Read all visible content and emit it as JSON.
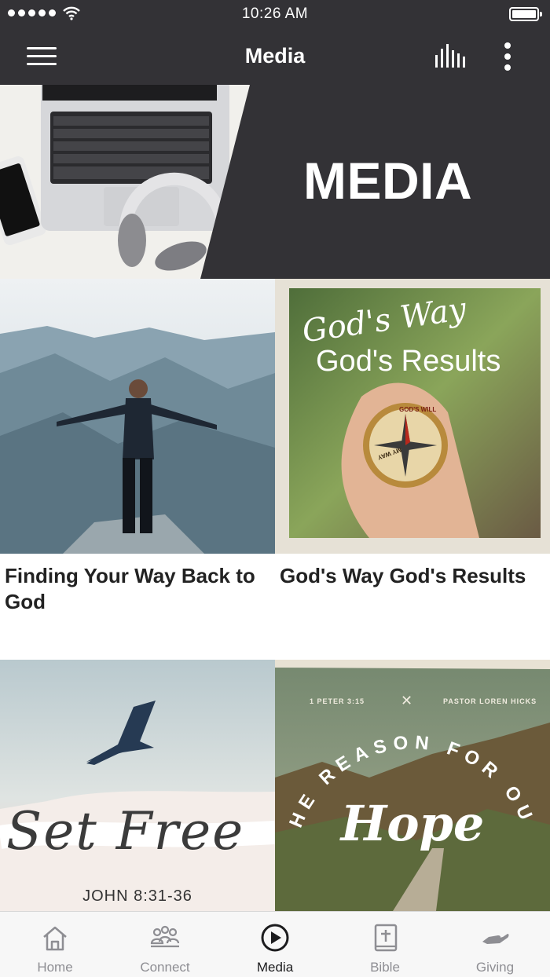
{
  "status_bar": {
    "time": "10:26 AM"
  },
  "header": {
    "title": "Media"
  },
  "hero": {
    "title": "MEDIA"
  },
  "media_items": [
    {
      "title": "Finding Your Way Back to God",
      "artwork": "mountain-man-image"
    },
    {
      "title": "God's Way God's Results",
      "artwork": "compass-hand-image",
      "art_text": {
        "script": "God's Way",
        "main": "God's Results",
        "compass": [
          "GOD'S WILL",
          "MY WAY"
        ]
      }
    },
    {
      "title": "",
      "artwork": "bird-sky-image",
      "art_text": {
        "script": "Set Free",
        "reference": "JOHN 8:31-36"
      }
    },
    {
      "title": "",
      "artwork": "road-valley-image",
      "art_text": {
        "left": "1 PETER 3:15",
        "right": "PASTOR LOREN HICKS",
        "arc": "THE REASON FOR OUR",
        "script": "Hope"
      }
    }
  ],
  "tabs": [
    {
      "label": "Home",
      "icon": "home-icon",
      "active": false
    },
    {
      "label": "Connect",
      "icon": "people-icon",
      "active": false
    },
    {
      "label": "Media",
      "icon": "play-circle-icon",
      "active": true
    },
    {
      "label": "Bible",
      "icon": "bible-icon",
      "active": false
    },
    {
      "label": "Giving",
      "icon": "giving-hand-icon",
      "active": false
    }
  ],
  "colors": {
    "bar_background": "#333236",
    "active_tab": "#1c1c1e",
    "inactive_tab": "#8e8e93"
  }
}
